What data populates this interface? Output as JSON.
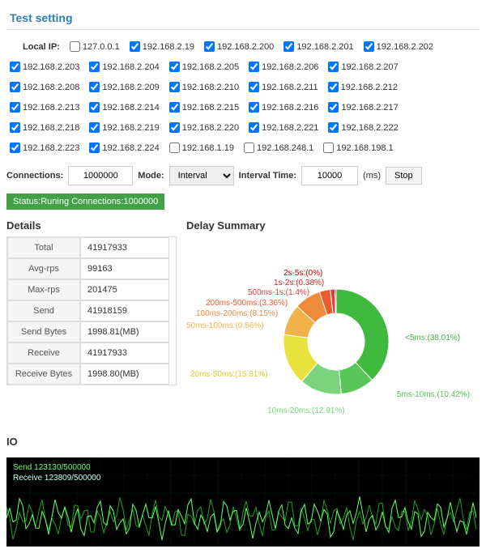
{
  "panel_title": "Test setting",
  "local_ip_label": "Local IP:",
  "ips": [
    {
      "ip": "127.0.0.1",
      "checked": false
    },
    {
      "ip": "192.168.2.19",
      "checked": true
    },
    {
      "ip": "192.168.2.200",
      "checked": true
    },
    {
      "ip": "192.168.2.201",
      "checked": true
    },
    {
      "ip": "192.168.2.202",
      "checked": true
    },
    {
      "ip": "192.168.2.203",
      "checked": true
    },
    {
      "ip": "192.168.2.204",
      "checked": true
    },
    {
      "ip": "192.168.2.205",
      "checked": true
    },
    {
      "ip": "192.168.2.206",
      "checked": true
    },
    {
      "ip": "192.168.2.207",
      "checked": true
    },
    {
      "ip": "192.168.2.208",
      "checked": true
    },
    {
      "ip": "192.168.2.209",
      "checked": true
    },
    {
      "ip": "192.168.2.210",
      "checked": true
    },
    {
      "ip": "192.168.2.211",
      "checked": true
    },
    {
      "ip": "192.168.2.212",
      "checked": true
    },
    {
      "ip": "192.168.2.213",
      "checked": true
    },
    {
      "ip": "192.168.2.214",
      "checked": true
    },
    {
      "ip": "192.168.2.215",
      "checked": true
    },
    {
      "ip": "192.168.2.216",
      "checked": true
    },
    {
      "ip": "192.168.2.217",
      "checked": true
    },
    {
      "ip": "192.168.2.218",
      "checked": true
    },
    {
      "ip": "192.168.2.219",
      "checked": true
    },
    {
      "ip": "192.168.2.220",
      "checked": true
    },
    {
      "ip": "192.168.2.221",
      "checked": true
    },
    {
      "ip": "192.168.2.222",
      "checked": true
    },
    {
      "ip": "192.168.2.223",
      "checked": true
    },
    {
      "ip": "192.168.2.224",
      "checked": true
    },
    {
      "ip": "192.168.1.19",
      "checked": false
    },
    {
      "ip": "192.168.248.1",
      "checked": false
    },
    {
      "ip": "192.168.198.1",
      "checked": false
    }
  ],
  "controls": {
    "connections_label": "Connections:",
    "connections_value": "1000000",
    "mode_label": "Mode:",
    "mode_value": "Interval",
    "interval_label": "Interval Time:",
    "interval_value": "10000",
    "interval_unit": "(ms)",
    "stop_label": "Stop"
  },
  "status": "Status:Runing Connections:1000000",
  "details_heading": "Details",
  "details": [
    {
      "k": "Total",
      "v": "41917933"
    },
    {
      "k": "Avg-rps",
      "v": "99163"
    },
    {
      "k": "Max-rps",
      "v": "201475"
    },
    {
      "k": "Send",
      "v": "41918159"
    },
    {
      "k": "Send Bytes",
      "v": "1998.81(MB)"
    },
    {
      "k": "Receive",
      "v": "41917933"
    },
    {
      "k": "Receive Bytes",
      "v": "1998.80(MB)"
    }
  ],
  "delay_heading": "Delay Summary",
  "io_heading": "IO",
  "io_legend": {
    "send": "Send 123130/500000",
    "receive": "Receive 123809/500000"
  },
  "chart_data": {
    "type": "pie",
    "title": "Delay Summary",
    "series": [
      {
        "name": "<5ms",
        "value": 38.01,
        "color": "#3fba3f",
        "label": "<5ms:(38.01%)"
      },
      {
        "name": "5ms-10ms",
        "value": 10.42,
        "color": "#58c658",
        "label": "5ms-10ms:(10.42%)"
      },
      {
        "name": "10ms-20ms",
        "value": 12.91,
        "color": "#7bd47b",
        "label": "10ms-20ms:(12.91%)"
      },
      {
        "name": "20ms-50ms",
        "value": 15.81,
        "color": "#e8e23e",
        "label": "20ms-50ms:(15.81%)"
      },
      {
        "name": "50ms-100ms",
        "value": 9.56,
        "color": "#f2b24a",
        "label": "50ms-100ms:(9.56%)"
      },
      {
        "name": "100ms-200ms",
        "value": 8.15,
        "color": "#ee8a3a",
        "label": "100ms-200ms:(8.15%)"
      },
      {
        "name": "200ms-500ms",
        "value": 3.36,
        "color": "#ea5b2f",
        "label": "200ms-500ms:(3.36%)"
      },
      {
        "name": "500ms-1s",
        "value": 1.4,
        "color": "#e53c3c",
        "label": "500ms-1s:(1.4%)"
      },
      {
        "name": "1s-2s",
        "value": 0.38,
        "color": "#e01f1f",
        "label": "1s-2s:(0.38%)"
      },
      {
        "name": "2s-5s",
        "value": 0,
        "color": "#cc0000",
        "label": "2s-5s:(0%)"
      }
    ],
    "label_positions": [
      {
        "i": 0,
        "x": 270,
        "y": 120,
        "c": "#3fba3f"
      },
      {
        "i": 1,
        "x": 260,
        "y": 190,
        "c": "#58c658"
      },
      {
        "i": 2,
        "x": 100,
        "y": 210,
        "c": "#7bd47b"
      },
      {
        "i": 3,
        "x": 5,
        "y": 165,
        "c": "#d6cc2c"
      },
      {
        "i": 4,
        "x": 0,
        "y": 105,
        "c": "#f2b24a"
      },
      {
        "i": 5,
        "x": 12,
        "y": 90,
        "c": "#ee8a3a"
      },
      {
        "i": 6,
        "x": 24,
        "y": 77,
        "c": "#ea5b2f"
      },
      {
        "i": 7,
        "x": 76,
        "y": 64,
        "c": "#e53c3c"
      },
      {
        "i": 8,
        "x": 108,
        "y": 52,
        "c": "#e01f1f"
      },
      {
        "i": 9,
        "x": 120,
        "y": 40,
        "c": "#cc0000"
      }
    ]
  }
}
